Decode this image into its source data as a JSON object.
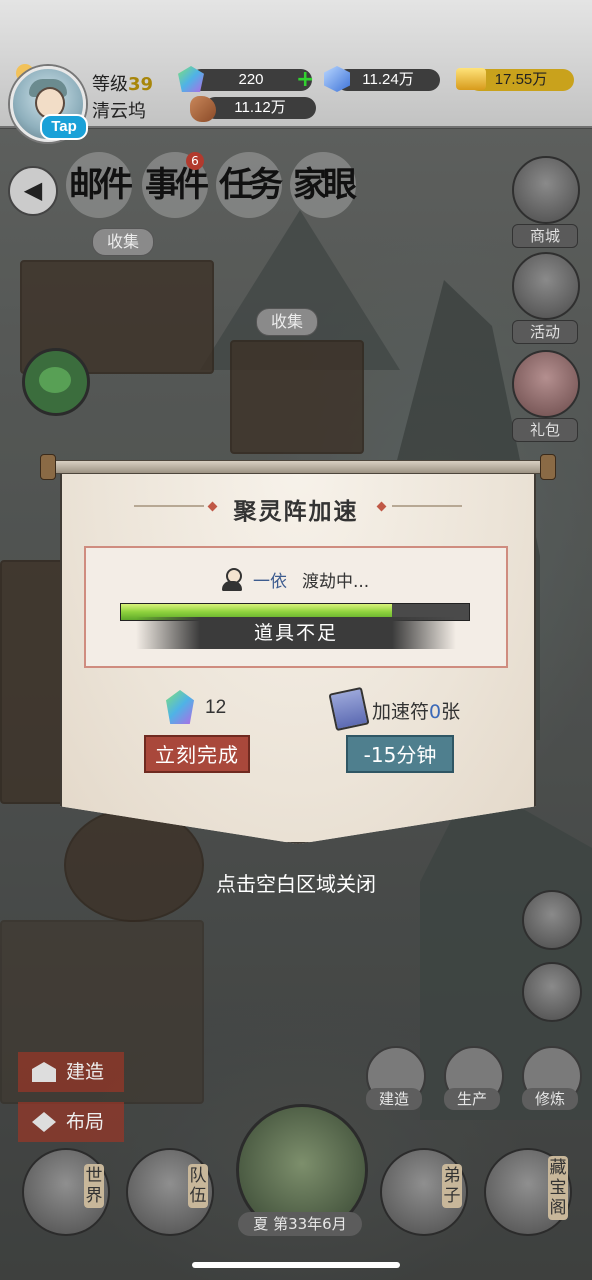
{
  "player": {
    "level_label": "等级",
    "level_value": "39",
    "location": "清云坞",
    "tap_label": "Tap"
  },
  "resources": {
    "gems": "220",
    "crystals": "11.24万",
    "gold": "17.55万",
    "meat": "11.12万"
  },
  "nav_tabs": [
    {
      "label": "邮件",
      "badge": ""
    },
    {
      "label": "事件",
      "badge": "6"
    },
    {
      "label": "任务",
      "badge": ""
    },
    {
      "label": "家眼",
      "badge": ""
    }
  ],
  "side_buttons": {
    "shop": "商城",
    "activity": "活动",
    "gift": "礼包"
  },
  "scene": {
    "collect_1": "收集",
    "collect_2": "收集"
  },
  "modal": {
    "title": "聚灵阵加速",
    "character_name": "一依",
    "character_status": "渡劫中...",
    "progress": 0.78,
    "insufficient_text": "道具不足",
    "gem_cost": "12",
    "ticket_label": "加速符",
    "ticket_count": "0",
    "ticket_unit": "张",
    "complete_button": "立刻完成",
    "speed_button": "-15分钟",
    "close_hint": "点击空白区域关闭"
  },
  "bottom": {
    "build": "建造",
    "layout": "布局",
    "tool_build": "建造",
    "tool_produce": "生产",
    "tool_cultivate": "修炼",
    "world": "世界",
    "team": "队伍",
    "disciple": "弟子",
    "treasure": "藏宝阁",
    "season": "夏",
    "date": "第33年6月"
  },
  "colors": {
    "accent_red": "#a9483b",
    "accent_teal": "#4f7f8e",
    "progress_green": "#8ed23d"
  }
}
